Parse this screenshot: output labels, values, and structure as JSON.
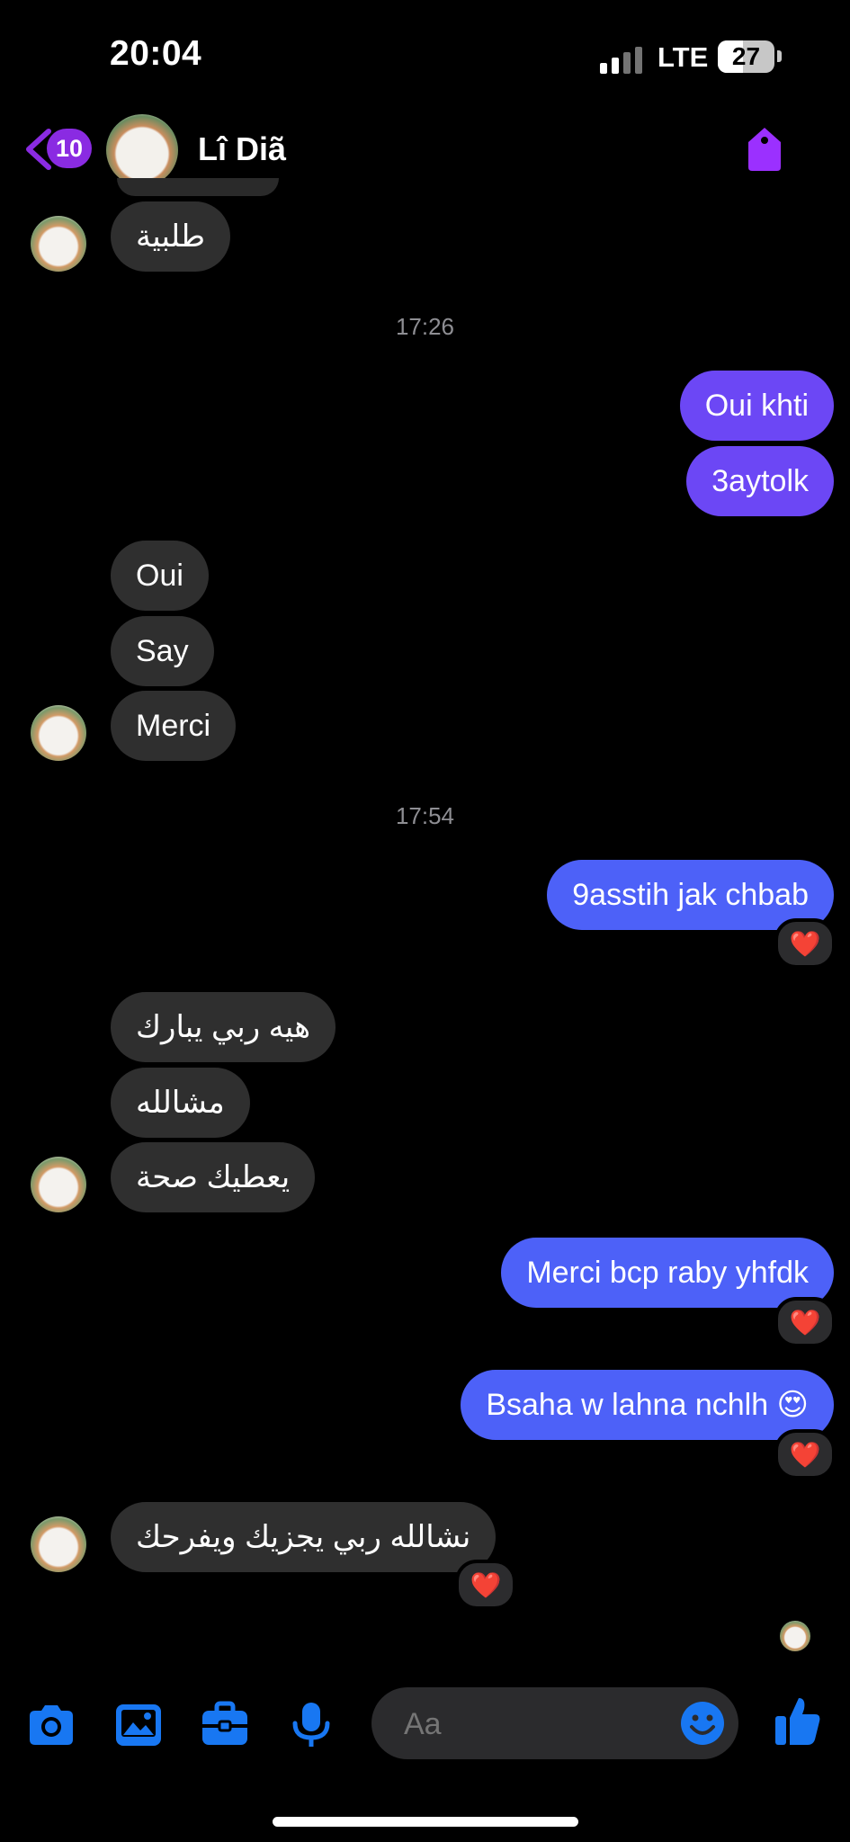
{
  "status_bar": {
    "time": "20:04",
    "network": "LTE",
    "battery": "27"
  },
  "header": {
    "back_count": "10",
    "contact_name": "Lî Diã"
  },
  "timestamps": [
    "17:26",
    "17:54"
  ],
  "messages": {
    "m0": "طلبية",
    "m1": "Oui khti",
    "m2": "3aytolk",
    "m3": "Oui",
    "m4": "Say",
    "m5": "Merci",
    "m6": "9asstih jak chbab",
    "m7": "هيه ربي يبارك",
    "m8": "مشالله",
    "m9": "يعطيك صحة",
    "m10": "Merci bcp raby yhfdk",
    "m11": "Bsaha w lahna nchlh 😍",
    "m12": "نشالله  ربي  يجزيك ويفرحك"
  },
  "reactions": {
    "heart": "❤️"
  },
  "composer": {
    "placeholder": "Aa"
  },
  "colors": {
    "outgoing": "#6c47f5",
    "outgoing_blue": "#4d61f8",
    "incoming": "#2f2f2f",
    "accent_purple": "#8a2be2",
    "toolbar_blue": "#1877f2"
  },
  "toolbar_icons": [
    "camera-icon",
    "image-icon",
    "briefcase-icon",
    "microphone-icon",
    "emoji-icon",
    "thumbs-up-icon"
  ]
}
